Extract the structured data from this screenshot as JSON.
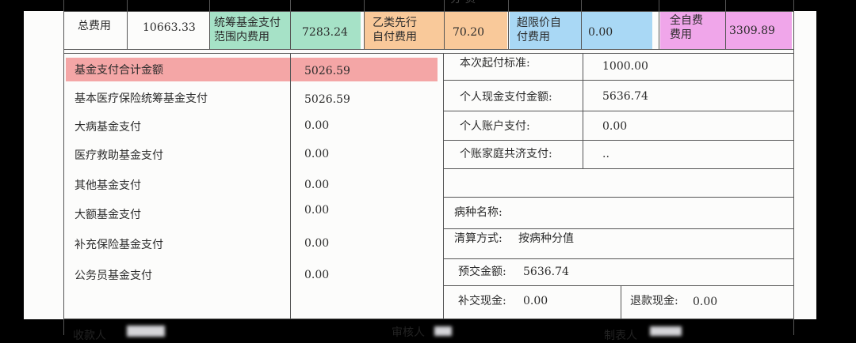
{
  "header_partial": "分 负",
  "top": {
    "total_label": "总费用",
    "total_value": "10663.33",
    "pool_label_1": "统筹基金支付",
    "pool_label_2": "范围内费用",
    "pool_value": "7283.24",
    "classb_label_1": "乙类先行",
    "classb_label_2": "自付费用",
    "classb_value": "70.20",
    "overlimit_label_1": "超限价自",
    "overlimit_label_2": "付费用",
    "overlimit_value": "0.00",
    "selfpay_label_1": "全自费",
    "selfpay_label_2": "费用",
    "selfpay_value": "3309.89"
  },
  "left_rows": [
    {
      "label": "基金支付合计金额",
      "value": "5026.59"
    },
    {
      "label": "基本医疗保险统筹基金支付",
      "value": "5026.59"
    },
    {
      "label": "大病基金支付",
      "value": "0.00"
    },
    {
      "label": "医疗救助基金支付",
      "value": "0.00"
    },
    {
      "label": "其他基金支付",
      "value": "0.00"
    },
    {
      "label": "大额基金支付",
      "value": "0.00"
    },
    {
      "label": "补充保险基金支付",
      "value": "0.00"
    },
    {
      "label": "公务员基金支付",
      "value": "0.00"
    }
  ],
  "right_rows": [
    {
      "label": "本次起付标准:",
      "value": "1000.00"
    },
    {
      "label": "个人现金支付金额:",
      "value": "5636.74"
    },
    {
      "label": "个人账户支付:",
      "value": "0.00"
    },
    {
      "label": "个账家庭共济支付:",
      "value": ".."
    }
  ],
  "right_info": {
    "disease_label": "病种名称:",
    "settlement_label": "清算方式:",
    "settlement_value": "按病种分值",
    "prepaid_label": "预交金额:",
    "prepaid_value": "5636.74",
    "supplement_label": "补交现金:",
    "supplement_value": "0.00",
    "refund_label": "退款现金:",
    "refund_value": "0.00"
  },
  "footer": {
    "cashier": "收款人",
    "reviewer": "审核人",
    "preparer": "制表人"
  },
  "colors": {
    "green": "#a6e2c7",
    "orange": "#f9c99a",
    "blue": "#a9d8f5",
    "magenta": "#f0a6ea",
    "red": "#f4a6a6"
  }
}
